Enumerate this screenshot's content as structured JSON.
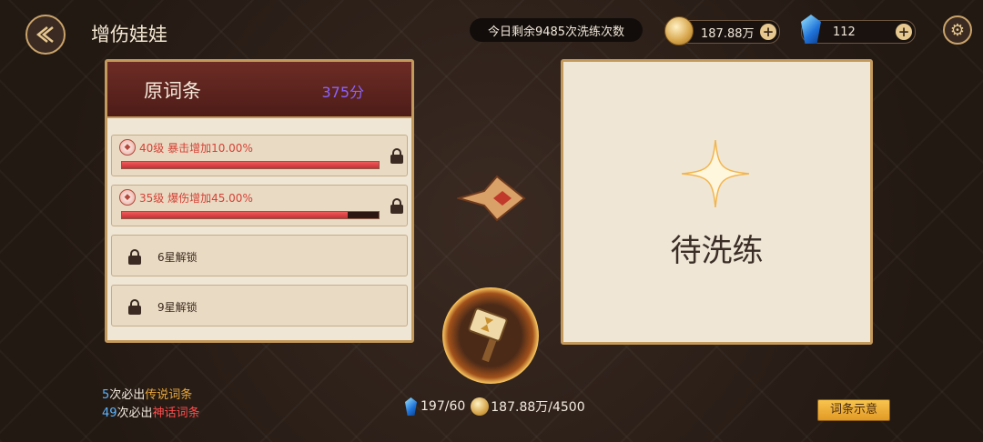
{
  "header": {
    "title": "增伤娃娃",
    "daily_remaining": "今日剩余9485次洗练次数",
    "gold_amount": "187.88万",
    "crystal_amount": "112",
    "plus_symbol": "+",
    "icons": {
      "back": "back-arrow-icon",
      "gold": "gold-coin-icon",
      "crystal": "blue-crystal-icon",
      "settings": "gear-icon"
    }
  },
  "original_panel": {
    "title": "原词条",
    "score": "375分",
    "attributes": [
      {
        "text": "40级 暴击增加10.00%",
        "fill_percent": 100,
        "locked": true
      },
      {
        "text": "35级 爆伤增加45.00%",
        "fill_percent": 88,
        "locked": true
      }
    ],
    "locked_slots": [
      "6星解锁",
      "9星解锁"
    ]
  },
  "result_panel": {
    "pending_text": "待洗练"
  },
  "guarantee": {
    "line1": {
      "count": "5",
      "prefix": "次必出",
      "tier": "传说词条"
    },
    "line2": {
      "count": "49",
      "prefix": "次必出",
      "tier": "神话词条"
    }
  },
  "cost": {
    "crystal": "197/60",
    "gold": "187.88万/4500"
  },
  "tip_button": "词条示意",
  "colors": {
    "accent_gold": "#c49a5c",
    "header_red": "#6d2c25",
    "attr_red": "#d64236",
    "score_purple": "#8a63ff"
  }
}
